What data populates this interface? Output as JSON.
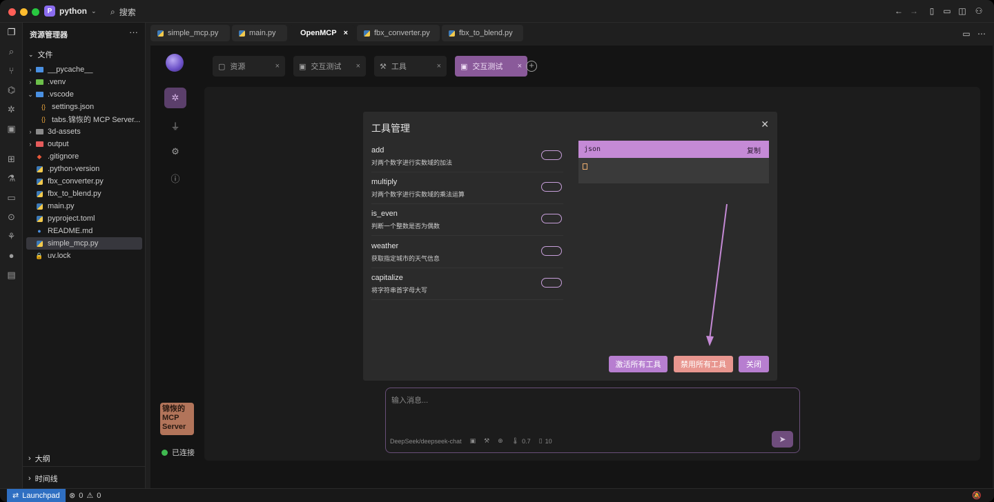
{
  "window": {
    "project_badge": "P",
    "project_name": "python",
    "search_label": "搜索"
  },
  "sidebar": {
    "title": "资源管理器",
    "more": "···",
    "section": "文件",
    "items": [
      {
        "label": "__pycache__",
        "type": "folder",
        "color": "#4a90e2"
      },
      {
        "label": ".venv",
        "type": "folder",
        "color": "#6cbf4a"
      },
      {
        "label": ".vscode",
        "type": "folder-open",
        "color": "#4a90e2"
      },
      {
        "label": "settings.json",
        "type": "json"
      },
      {
        "label": "tabs.锦恢的 MCP Server...",
        "type": "json"
      },
      {
        "label": "3d-assets",
        "type": "folder",
        "color": "#8a8a8a"
      },
      {
        "label": "output",
        "type": "folder",
        "color": "#e55b5b"
      },
      {
        "label": ".gitignore",
        "type": "git"
      },
      {
        "label": ".python-version",
        "type": "py"
      },
      {
        "label": "fbx_converter.py",
        "type": "py"
      },
      {
        "label": "fbx_to_blend.py",
        "type": "py"
      },
      {
        "label": "main.py",
        "type": "py"
      },
      {
        "label": "pyproject.toml",
        "type": "toml"
      },
      {
        "label": "README.md",
        "type": "md"
      },
      {
        "label": "simple_mcp.py",
        "type": "py"
      },
      {
        "label": "uv.lock",
        "type": "lock"
      }
    ],
    "outline": "大纲",
    "timeline": "时间线"
  },
  "editor_tabs": [
    {
      "label": "simple_mcp.py"
    },
    {
      "label": "main.py"
    },
    {
      "label": "OpenMCP"
    },
    {
      "label": "fbx_converter.py"
    },
    {
      "label": "fbx_to_blend.py"
    }
  ],
  "mcp": {
    "tabs": [
      {
        "label": "资源",
        "icon": "folder-icon"
      },
      {
        "label": "交互测试",
        "icon": "robot-icon"
      },
      {
        "label": "工具",
        "icon": "wrench-icon"
      },
      {
        "label": "交互测试",
        "icon": "robot-icon"
      }
    ],
    "close_glyph": "×",
    "server_name": "锦恢的 MCP Server",
    "status": "已连接"
  },
  "dialog": {
    "title": "工具管理",
    "tools": [
      {
        "name": "add",
        "desc": "对两个数字进行实数域的加法"
      },
      {
        "name": "multiply",
        "desc": "对两个数字进行实数域的乘法运算"
      },
      {
        "name": "is_even",
        "desc": "判断一个整数是否为偶数"
      },
      {
        "name": "weather",
        "desc": "获取指定城市的天气信息"
      },
      {
        "name": "capitalize",
        "desc": "将字符串首字母大写"
      }
    ],
    "json_lang": "json",
    "copy": "复制",
    "buttons": {
      "enable_all": "激活所有工具",
      "disable_all": "禁用所有工具",
      "close": "关闭"
    },
    "colors": {
      "accent": "#c58ad6",
      "danger": "#e8968f"
    }
  },
  "chat": {
    "placeholder": "输入消息...",
    "model": "DeepSeek/deepseek-chat",
    "temperature": "0.7",
    "context": "10"
  },
  "status": {
    "launchpad": "Launchpad",
    "errors": "0",
    "warnings": "0"
  }
}
